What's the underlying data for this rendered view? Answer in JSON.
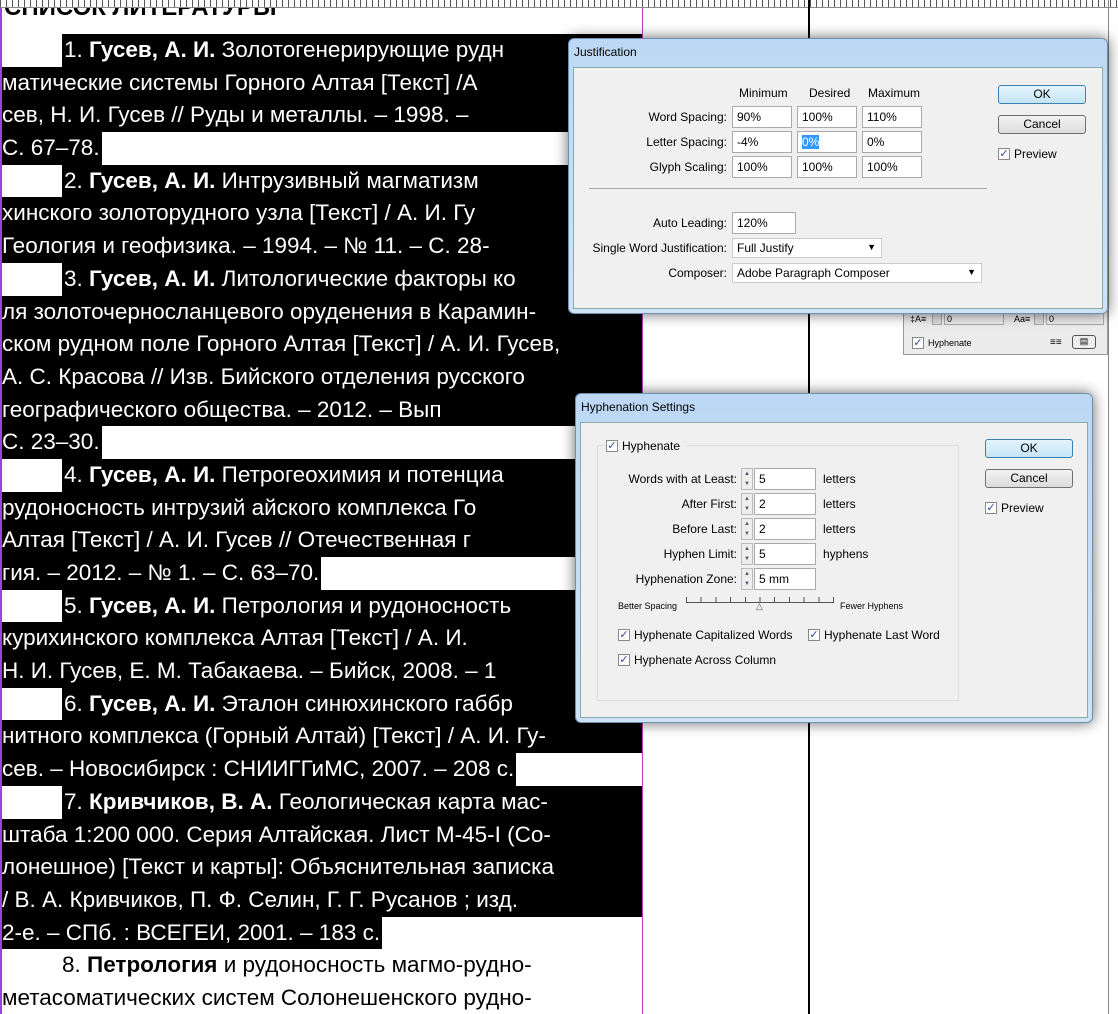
{
  "document": {
    "heading": "СПИСОК ЛИТЕРАТУРЫ",
    "lines": [
      {
        "kind": "first",
        "num": "1. ",
        "bold": "Гусев, А. И.",
        "text": " Золотогенерирующие рудн"
      },
      {
        "kind": "full",
        "text": "матические системы Горного Алтая [Текст] /А"
      },
      {
        "kind": "full",
        "text": "сев, Н. И. Гусев // Руды и металлы. – 1998. –"
      },
      {
        "kind": "last",
        "text": "С. 67–78."
      },
      {
        "kind": "first",
        "num": "2. ",
        "bold": "Гусев, А. И.",
        "text": " Интрузивный  магматизм"
      },
      {
        "kind": "full",
        "text": "хинского золоторудного узла [Текст] / А. И. Гу"
      },
      {
        "kind": "full",
        "text": "Геология и геофизика. – 1994. – № 11. – С. 28-"
      },
      {
        "kind": "first",
        "num": "3. ",
        "bold": "Гусев, А. И.",
        "text": " Литологические факторы ко"
      },
      {
        "kind": "full",
        "text": "ля золоточерносланцевого оруденения в Карамин-"
      },
      {
        "kind": "full",
        "text": "ском рудном поле Горного Алтая [Текст] / А. И. Гусев,"
      },
      {
        "kind": "full",
        "text": "А. С. Красова // Изв. Бийского отделения русского"
      },
      {
        "kind": "full",
        "text": "географического   общества. –   2012. –   Вып"
      },
      {
        "kind": "last",
        "text": "С. 23–30."
      },
      {
        "kind": "first",
        "num": "4. ",
        "bold": "Гусев, А. И.",
        "text": " Петрогеохимия и потенциа"
      },
      {
        "kind": "full",
        "text": "рудоносность интрузий айского комплекса Го"
      },
      {
        "kind": "full",
        "text": "Алтая  [Текст] /  А. И. Гусев //  Отечественная  г"
      },
      {
        "kind": "last",
        "text": "гия. – 2012. – № 1. – С. 63–70."
      },
      {
        "kind": "first",
        "num": "5. ",
        "bold": "Гусев, А. И.",
        "text": " Петрология и рудоносность"
      },
      {
        "kind": "full",
        "text": "курихинского комплекса Алтая [Текст] / А. И."
      },
      {
        "kind": "full",
        "text": "Н. И. Гусев, Е. М. Табакаева. – Бийск, 2008. – 1"
      },
      {
        "kind": "first",
        "num": "6. ",
        "bold": "Гусев, А. И.",
        "text": " Эталон синюхинского габбр"
      },
      {
        "kind": "full",
        "text": "нитного комплекса (Горный Алтай) [Текст] / А. И. Гу-"
      },
      {
        "kind": "last",
        "text": "сев. – Новосибирск : СНИИГГиМС, 2007. – 208 с."
      },
      {
        "kind": "first",
        "num": "7. ",
        "bold": "Кривчиков, В. А.",
        "text": " Геологическая  карта  мас-"
      },
      {
        "kind": "full",
        "text": "штаба 1:200 000. Серия Алтайская. Лист М-45-I (Со-"
      },
      {
        "kind": "full",
        "text": "лонешное) [Текст и карты]: Объяснительная записка"
      },
      {
        "kind": "full",
        "text": "/  В. А. Кривчиков,  П. Ф. Селин,  Г. Г. Русанов ;  изд."
      },
      {
        "kind": "last",
        "text": "2-е. – СПб. : ВСЕГЕИ, 2001. – 183 с."
      },
      {
        "kind": "plain-first",
        "num": "8. ",
        "bold": "Петрология",
        "text": "  и рудоносность  магмо-рудно-"
      },
      {
        "kind": "plain",
        "text": "метасоматических систем Солонешенского рудно-"
      }
    ]
  },
  "paragraph_panel": {
    "leading_value": "0",
    "case_value": "0",
    "hyphenate_label": "Hyphenate",
    "hyphenate_checked": true
  },
  "justification": {
    "title": "Justification",
    "columns": [
      "Minimum",
      "Desired",
      "Maximum"
    ],
    "rows": [
      {
        "label": "Word Spacing:",
        "values": [
          "90%",
          "100%",
          "110%"
        ]
      },
      {
        "label": "Letter Spacing:",
        "values": [
          "-4%",
          "0%",
          "0%"
        ]
      },
      {
        "label": "Glyph Scaling:",
        "values": [
          "100%",
          "100%",
          "100%"
        ]
      }
    ],
    "auto_leading_label": "Auto Leading:",
    "auto_leading": "120%",
    "single_word_label": "Single Word Justification:",
    "single_word": "Full Justify",
    "composer_label": "Composer:",
    "composer": "Adobe Paragraph Composer",
    "ok": "OK",
    "cancel": "Cancel",
    "preview": "Preview",
    "preview_checked": true
  },
  "hyphenation": {
    "title": "Hyphenation Settings",
    "hyphenate": "Hyphenate",
    "hyphenate_checked": true,
    "fields": [
      {
        "label": "Words with at Least:",
        "value": "5",
        "unit": "letters"
      },
      {
        "label": "After First:",
        "value": "2",
        "unit": "letters"
      },
      {
        "label": "Before Last:",
        "value": "2",
        "unit": "letters"
      },
      {
        "label": "Hyphen Limit:",
        "value": "5",
        "unit": "hyphens"
      },
      {
        "label": "Hyphenation Zone:",
        "value": "5 mm",
        "unit": ""
      }
    ],
    "slider_left": "Better Spacing",
    "slider_right": "Fewer Hyphens",
    "slider_position": 0.5,
    "cap_words": "Hyphenate Capitalized Words",
    "last_word": "Hyphenate Last Word",
    "across_column": "Hyphenate Across Column",
    "ok": "OK",
    "cancel": "Cancel",
    "preview": "Preview"
  }
}
